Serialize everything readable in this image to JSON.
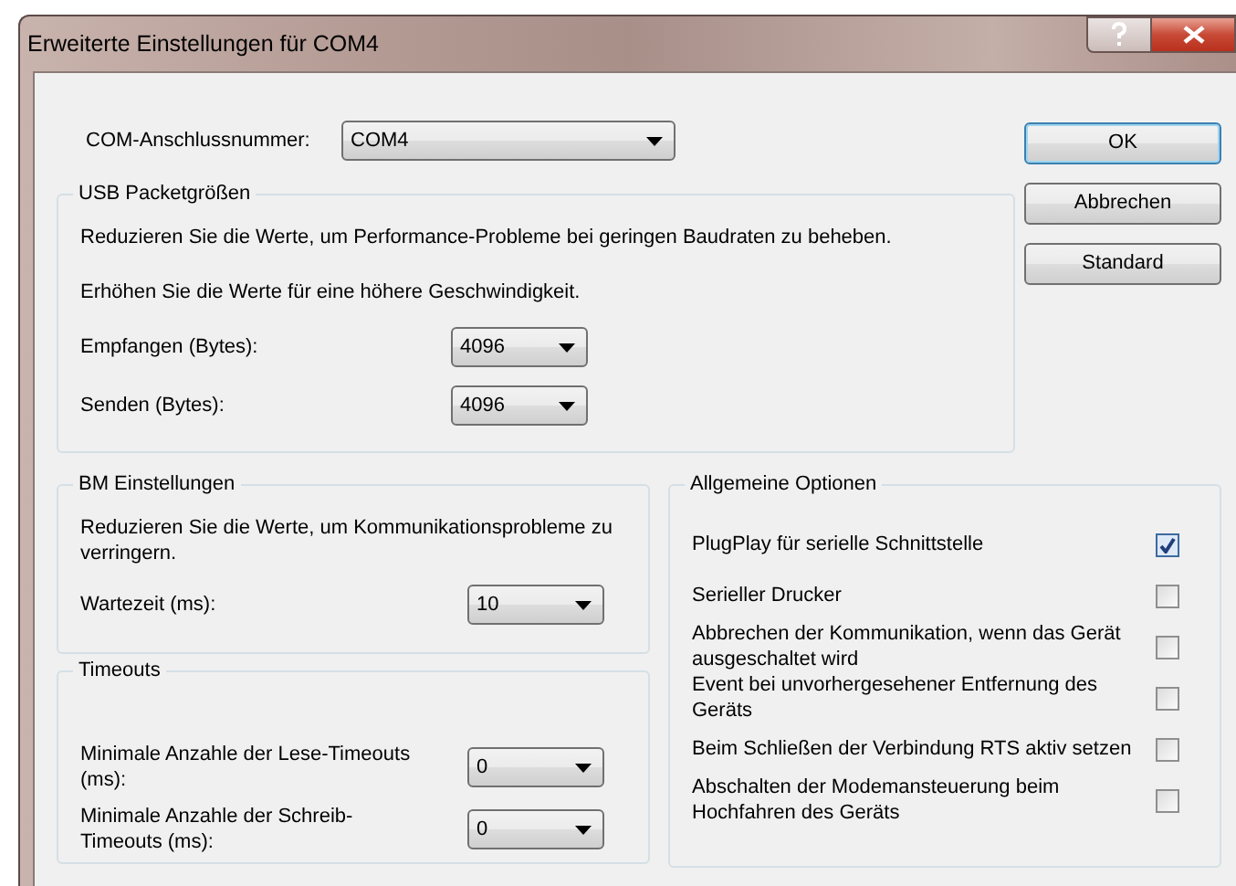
{
  "window": {
    "title": "Erweiterte Einstellungen für COM4"
  },
  "com_port": {
    "label": "COM-Anschlussnummer:",
    "value": "COM4"
  },
  "buttons": [
    {
      "label": "OK",
      "default": true
    },
    {
      "label": "Abbrechen",
      "default": false
    },
    {
      "label": "Standard",
      "default": false
    }
  ],
  "usb_group": {
    "title": "USB Packetgrößen",
    "notes": [
      "Reduzieren Sie die Werte, um Performance-Probleme bei geringen Baudraten zu beheben.",
      "Erhöhen Sie die Werte für eine höhere Geschwindigkeit."
    ],
    "fields": [
      {
        "label": "Empfangen (Bytes):",
        "value": "4096"
      },
      {
        "label": "Senden (Bytes):",
        "value": "4096"
      }
    ]
  },
  "bm_group": {
    "title": "BM Einstellungen",
    "notes": [
      "Reduzieren Sie die Werte, um Kommunikationsprobleme zu verringern."
    ],
    "fields": [
      {
        "label": "Wartezeit (ms):",
        "value": "10"
      }
    ]
  },
  "timeouts_group": {
    "title": "Timeouts",
    "fields": [
      {
        "label": "Minimale Anzahle der Lese-Timeouts (ms):",
        "value": "0"
      },
      {
        "label": "Minimale Anzahle der Schreib-Timeouts (ms):",
        "value": "0"
      }
    ]
  },
  "options_group": {
    "title": "Allgemeine Optionen",
    "options": [
      {
        "label": "PlugPlay für serielle Schnittstelle",
        "checked": true
      },
      {
        "label": "Serieller Drucker",
        "checked": false
      },
      {
        "label": "Abbrechen der Kommunikation, wenn das Gerät ausgeschaltet wird",
        "checked": false
      },
      {
        "label": "Event bei unvorhergesehener Entfernung des Geräts",
        "checked": false
      },
      {
        "label": "Beim Schließen der Verbindung RTS aktiv setzen",
        "checked": false
      },
      {
        "label": "Abschalten der Modemansteuerung beim Hochfahren des Geräts",
        "checked": false
      }
    ]
  }
}
